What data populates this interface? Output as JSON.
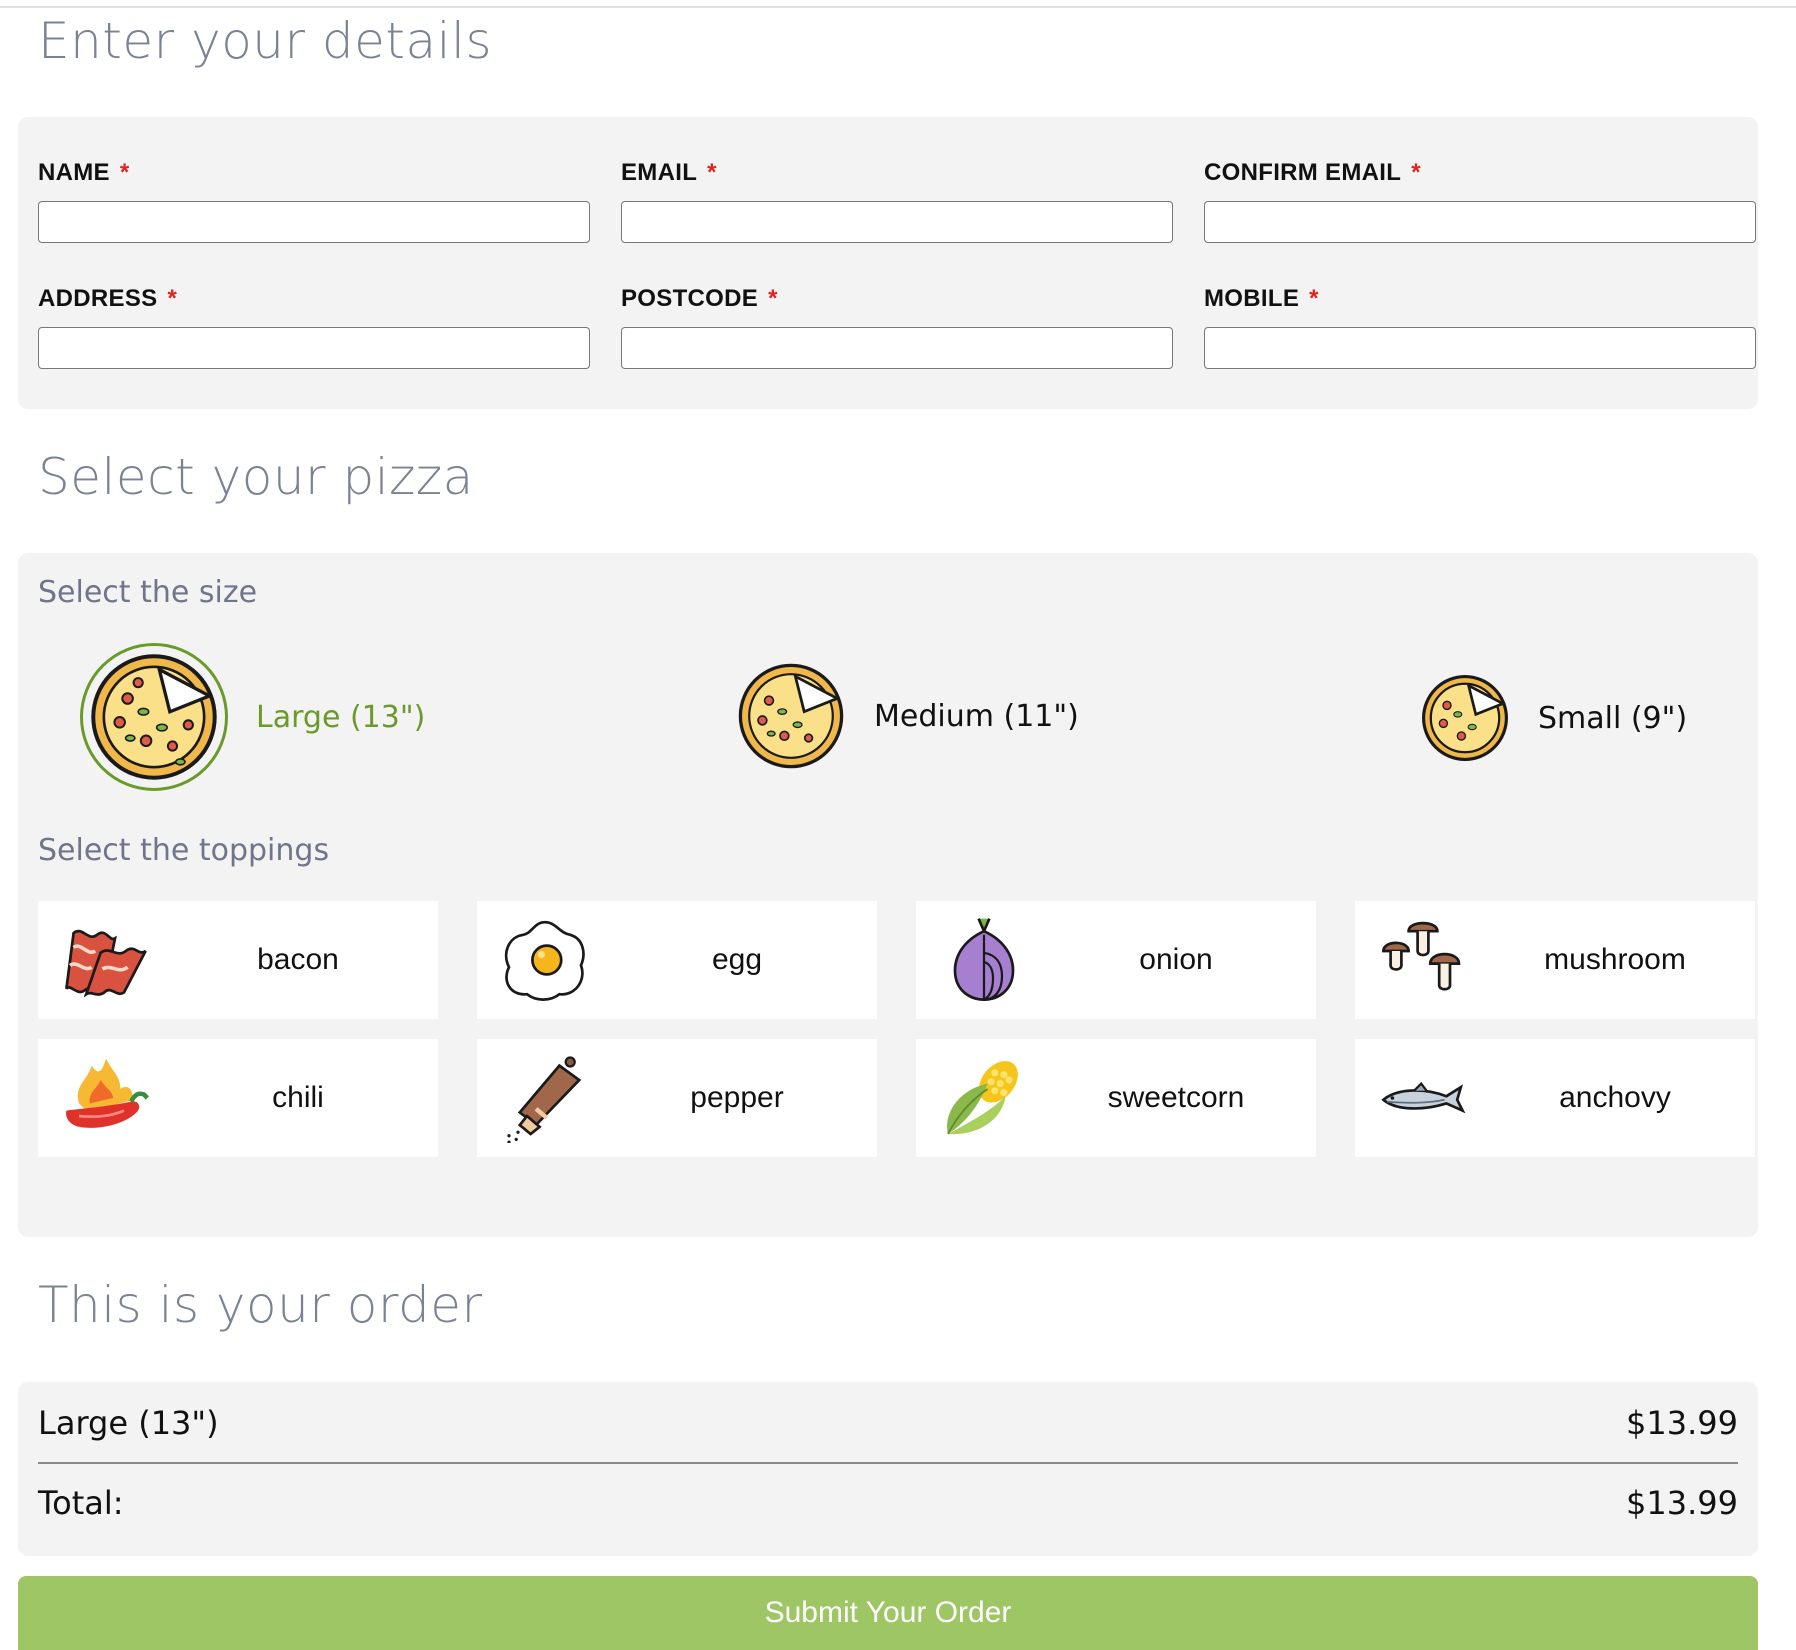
{
  "details": {
    "heading": "Enter your details",
    "required_mark": "*",
    "fields": [
      {
        "label": "NAME",
        "value": ""
      },
      {
        "label": "EMAIL",
        "value": ""
      },
      {
        "label": "CONFIRM EMAIL",
        "value": ""
      },
      {
        "label": "ADDRESS",
        "value": ""
      },
      {
        "label": "POSTCODE",
        "value": ""
      },
      {
        "label": "MOBILE",
        "value": ""
      }
    ]
  },
  "pizza": {
    "heading": "Select your pizza",
    "size_subhead": "Select the size",
    "sizes": [
      {
        "label": "Large (13\")",
        "selected": true
      },
      {
        "label": "Medium (11\")",
        "selected": false
      },
      {
        "label": "Small (9\")",
        "selected": false
      }
    ],
    "toppings_subhead": "Select the toppings",
    "toppings": [
      {
        "label": "bacon",
        "icon": "bacon-icon"
      },
      {
        "label": "egg",
        "icon": "egg-icon"
      },
      {
        "label": "onion",
        "icon": "onion-icon"
      },
      {
        "label": "mushroom",
        "icon": "mushroom-icon"
      },
      {
        "label": "chili",
        "icon": "chili-icon"
      },
      {
        "label": "pepper",
        "icon": "pepper-grinder-icon"
      },
      {
        "label": "sweetcorn",
        "icon": "sweetcorn-icon"
      },
      {
        "label": "anchovy",
        "icon": "anchovy-icon"
      }
    ]
  },
  "order": {
    "heading": "This is your order",
    "items": [
      {
        "name": "Large (13\")",
        "price": "$13.99"
      }
    ],
    "total_label": "Total:",
    "total_value": "$13.99"
  },
  "submit_label": "Submit Your Order",
  "colors": {
    "accent_green": "#9ec665",
    "selected_green": "#6a9a2a",
    "required_red": "#e0241d",
    "heading_gray": "#7b8294",
    "panel_bg": "#f3f3f3"
  }
}
